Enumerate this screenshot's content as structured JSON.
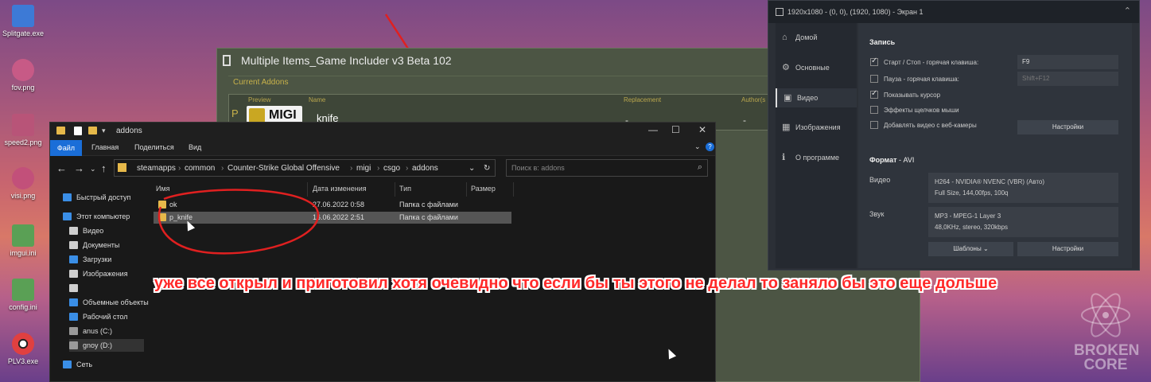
{
  "desktop": {
    "icons": [
      {
        "label": "Splitgate.exe",
        "color": "#3d7ad6"
      },
      {
        "label": "fov.png",
        "color": "#c75a86"
      },
      {
        "label": "speed2.png",
        "color": "#b85478"
      },
      {
        "label": "visi.png",
        "color": "#c2507a"
      },
      {
        "label": "imgui.ini",
        "color": "#5aa055"
      },
      {
        "label": "config.ini",
        "color": "#5aa055"
      },
      {
        "label": "PLV3.exe",
        "color": "#e04040"
      }
    ]
  },
  "mi_app": {
    "title": "Multiple Items_Game Includer v3 Beta 102",
    "section": "Current Addons",
    "columns": {
      "preview": "Preview",
      "name": "Name",
      "replacement": "Replacement",
      "author": "Author(s"
    },
    "row": {
      "p": "P",
      "logo": "MIGI",
      "name": "knife",
      "replacement": "-",
      "author": "-"
    }
  },
  "explorer": {
    "title": "addons",
    "ribbon": {
      "file": "Файл",
      "home": "Главная",
      "share": "Поделиться",
      "view": "Вид"
    },
    "breadcrumbs": [
      "steamapps",
      "common",
      "Counter-Strike Global Offensive",
      "migi",
      "csgo",
      "addons"
    ],
    "search_placeholder": "Поиск в: addons",
    "sidebar": [
      {
        "label": "Быстрый доступ",
        "color": "#3a8ee6"
      },
      {
        "label": "Этот компьютер",
        "color": "#3a8ee6"
      },
      {
        "label": "Видео",
        "color": "#cfcfcf"
      },
      {
        "label": "Документы",
        "color": "#cfcfcf"
      },
      {
        "label": "Загрузки",
        "color": "#3a8ee6"
      },
      {
        "label": "Изображения",
        "color": "#cfcfcf"
      },
      {
        "label": "",
        "color": "#cfcfcf"
      },
      {
        "label": "Объемные объекты",
        "color": "#3a8ee6"
      },
      {
        "label": "Рабочий стол",
        "color": "#3a8ee6"
      },
      {
        "label": "anus (C:)",
        "color": "#9a9a9a"
      },
      {
        "label": "gnoy (D:)",
        "color": "#9a9a9a"
      },
      {
        "label": "Сеть",
        "color": "#3a8ee6"
      }
    ],
    "columns": {
      "name": "Имя",
      "date": "Дата изменения",
      "type": "Тип",
      "size": "Размер"
    },
    "rows": [
      {
        "name": "ok",
        "date": "27.06.2022 0:58",
        "type": "Папка с файлами"
      },
      {
        "name": "p_knife",
        "date": "16.06.2022 2:51",
        "type": "Папка с файлами"
      }
    ]
  },
  "recorder": {
    "top_label": "1920x1080 - (0, 0), (1920, 1080) - Экран 1",
    "nav": [
      "Домой",
      "Основные",
      "Видео",
      "Изображения",
      "О программе"
    ],
    "rec_header": "Запись",
    "options": [
      {
        "label": "Старт / Стоп - горячая клавиша:",
        "checked": true,
        "value": "F9"
      },
      {
        "label": "Пауза - горячая клавиша:",
        "checked": false,
        "value": "Shift+F12"
      },
      {
        "label": "Показывать курсор",
        "checked": true
      },
      {
        "label": "Эффекты щелчков мыши",
        "checked": false
      },
      {
        "label": "Добавлять видео с веб-камеры",
        "checked": false
      }
    ],
    "settings_button": "Настройки",
    "format_header": "Формат",
    "format_value": "- AVI",
    "video_label": "Видео",
    "video_line1": "H264 - NVIDIA® NVENC (VBR) (Авто)",
    "video_line2": "Full Size, 144,00fps, 100q",
    "audio_label": "Звук",
    "audio_line1": "MP3 - MPEG-1 Layer 3",
    "audio_line2": "48,0KHz, stereo, 320kbps",
    "templates_button": "Шаблоны",
    "settings_button2": "Настройки"
  },
  "caption": "уже все открыл и приготовил хотя очевидно что если бы ты этого не делал то заняло бы это еще дольше",
  "watermark": [
    "BROKEN",
    "CORE"
  ]
}
